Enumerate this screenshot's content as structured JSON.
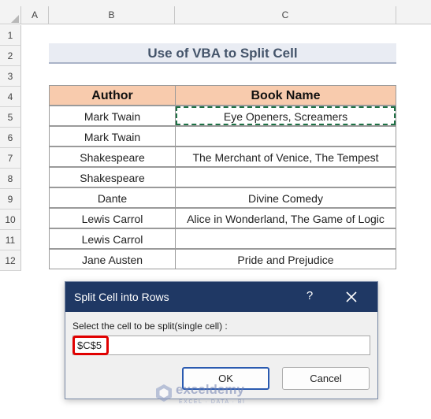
{
  "columns": [
    "A",
    "B",
    "C"
  ],
  "rows": [
    "1",
    "2",
    "3",
    "4",
    "5",
    "6",
    "7",
    "8",
    "9",
    "10",
    "11",
    "12"
  ],
  "sheet": {
    "title": "Use of VBA to Split Cell",
    "headers": {
      "author": "Author",
      "book": "Book Name"
    },
    "table": [
      {
        "author": "Mark Twain",
        "book": "Eye Openers, Screamers"
      },
      {
        "author": "Mark Twain",
        "book": ""
      },
      {
        "author": "Shakespeare",
        "book": "The Merchant of Venice, The Tempest"
      },
      {
        "author": "Shakespeare",
        "book": ""
      },
      {
        "author": "Dante",
        "book": "Divine Comedy"
      },
      {
        "author": "Lewis Carrol",
        "book": "Alice in Wonderland, The Game of Logic"
      },
      {
        "author": "Lewis Carrol",
        "book": ""
      },
      {
        "author": "Jane Austen",
        "book": "Pride and Prejudice"
      }
    ],
    "colors": {
      "header_fill": "#f8cbad",
      "title_fill": "#e9ecf3",
      "title_text": "#44546a"
    }
  },
  "dialog": {
    "title": "Split Cell into Rows",
    "help_glyph": "?",
    "prompt": "Select the cell to be split(single cell) :",
    "input_value": "$C$5",
    "ok_label": "OK",
    "cancel_label": "Cancel",
    "colors": {
      "titlebar": "#1f3864",
      "highlight": "#e00000"
    },
    "icons": {
      "close": "close-icon"
    }
  },
  "watermark": {
    "name": "exceldemy",
    "tagline": "EXCEL · DATA · BI"
  }
}
